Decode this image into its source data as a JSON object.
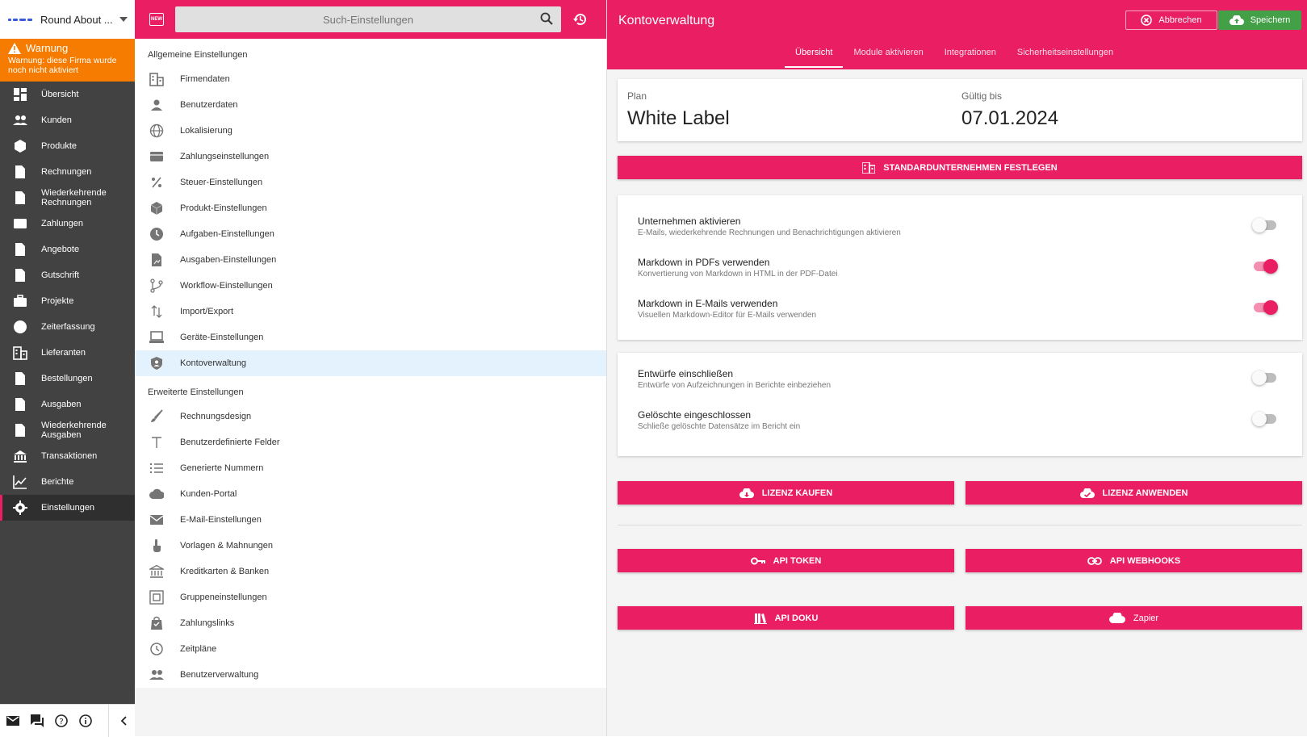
{
  "nav": {
    "company": "Round About ...",
    "warning_title": "Warnung",
    "warning_text": "Warnung: diese Firma wurde noch nicht aktiviert",
    "items": [
      {
        "label": "Übersicht",
        "icon": "dashboard-icon"
      },
      {
        "label": "Kunden",
        "icon": "people-icon"
      },
      {
        "label": "Produkte",
        "icon": "cube-icon"
      },
      {
        "label": "Rechnungen",
        "icon": "invoice-icon"
      },
      {
        "label": "Wiederkehrende Rechnungen",
        "icon": "recurring-icon"
      },
      {
        "label": "Zahlungen",
        "icon": "credit-card-icon"
      },
      {
        "label": "Angebote",
        "icon": "quote-icon"
      },
      {
        "label": "Gutschrift",
        "icon": "credit-icon"
      },
      {
        "label": "Projekte",
        "icon": "briefcase-icon"
      },
      {
        "label": "Zeiterfassung",
        "icon": "clock-icon"
      },
      {
        "label": "Lieferanten",
        "icon": "building-icon"
      },
      {
        "label": "Bestellungen",
        "icon": "order-icon"
      },
      {
        "label": "Ausgaben",
        "icon": "expense-icon"
      },
      {
        "label": "Wiederkehrende Ausgaben",
        "icon": "recurring-icon"
      },
      {
        "label": "Transaktionen",
        "icon": "bank-icon"
      },
      {
        "label": "Berichte",
        "icon": "chart-icon"
      },
      {
        "label": "Einstellungen",
        "icon": "gear-icon"
      }
    ]
  },
  "settings": {
    "search_placeholder": "Such-Einstellungen",
    "new_badge": "NEW",
    "group_basic": "Allgemeine Einstellungen",
    "basic": [
      "Firmendaten",
      "Benutzerdaten",
      "Lokalisierung",
      "Zahlungseinstellungen",
      "Steuer-Einstellungen",
      "Produkt-Einstellungen",
      "Aufgaben-Einstellungen",
      "Ausgaben-Einstellungen",
      "Workflow-Einstellungen",
      "Import/Export",
      "Geräte-Einstellungen",
      "Kontoverwaltung"
    ],
    "group_advanced": "Erweiterte Einstellungen",
    "advanced": [
      "Rechnungsdesign",
      "Benutzerdefinierte Felder",
      "Generierte Nummern",
      "Kunden-Portal",
      "E-Mail-Einstellungen",
      "Vorlagen & Mahnungen",
      "Kreditkarten & Banken",
      "Gruppeneinstellungen",
      "Zahlungslinks",
      "Zeitpläne",
      "Benutzerverwaltung"
    ]
  },
  "main": {
    "title": "Kontoverwaltung",
    "cancel": "Abbrechen",
    "save": "Speichern",
    "tabs": [
      "Übersicht",
      "Module aktivieren",
      "Integrationen",
      "Sicherheitseinstellungen"
    ],
    "plan_label": "Plan",
    "plan_value": "White Label",
    "valid_label": "Gültig bis",
    "valid_value": "07.01.2024",
    "default_company_btn": "STANDARDUNTERNEHMEN FESTLEGEN",
    "toggles1": [
      {
        "title": "Unternehmen aktivieren",
        "sub": "E-Mails, wiederkehrende Rechnungen und Benachrichtigungen aktivieren",
        "on": false
      },
      {
        "title": "Markdown in PDFs verwenden",
        "sub": "Konvertierung von Markdown in HTML in der PDF-Datei",
        "on": true
      },
      {
        "title": "Markdown in E-Mails verwenden",
        "sub": "Visuellen Markdown-Editor für E-Mails verwenden",
        "on": true
      }
    ],
    "toggles2": [
      {
        "title": "Entwürfe einschließen",
        "sub": "Entwürfe von Aufzeichnungen in Berichte einbeziehen",
        "on": false
      },
      {
        "title": "Gelöschte eingeschlossen",
        "sub": "Schließe gelöschte Datensätze im Bericht ein",
        "on": false
      }
    ],
    "buy_license": "LIZENZ KAUFEN",
    "apply_license": "LIZENZ ANWENDEN",
    "api_token": "API TOKEN",
    "api_webhooks": "API WEBHOOKS",
    "api_docs": "API DOKU",
    "zapier": "Zapier"
  },
  "colors": {
    "accent": "#e91e63",
    "warning": "#f57c00",
    "nav_bg": "#424242",
    "save": "#43a047"
  }
}
